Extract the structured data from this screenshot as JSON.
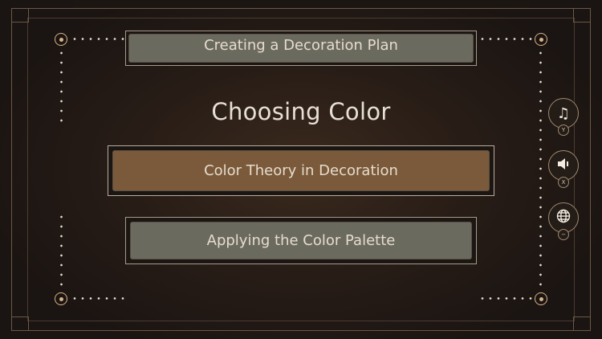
{
  "menu": {
    "section_title": "Choosing Color",
    "items": [
      {
        "label": "Creating a Decoration Plan",
        "state": "partially-visible"
      },
      {
        "label": "Color Theory in Decoration",
        "state": "selected"
      },
      {
        "label": "Applying the Color Palette",
        "state": "normal"
      }
    ]
  },
  "side_controls": [
    {
      "icon": "music-note-icon",
      "glyph": "♫",
      "hint": "Y"
    },
    {
      "icon": "speaker-icon",
      "glyph": "🔈",
      "hint": "X"
    },
    {
      "icon": "globe-icon",
      "glyph": "🌐",
      "hint": "−"
    }
  ],
  "colors": {
    "background": "#2a1e17",
    "selected": "#7a5a3a",
    "normal": "#6b6a5f",
    "accent": "#d9b48a",
    "text": "#e6dccd"
  }
}
